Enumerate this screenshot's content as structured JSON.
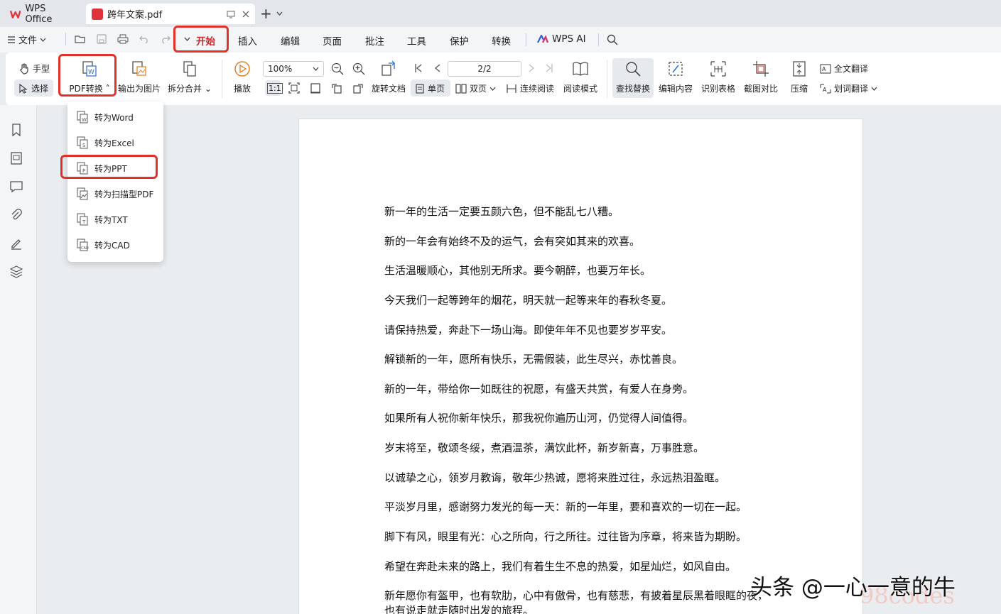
{
  "titlebar": {
    "app_tab_label": "WPS Office",
    "doc_tab_label": "跨年文案.pdf",
    "new_tab_symbol": "+",
    "brand_color": "#e0323a"
  },
  "menubar": {
    "file_label": "文件",
    "items": [
      {
        "label": "开始"
      },
      {
        "label": "插入"
      },
      {
        "label": "编辑"
      },
      {
        "label": "页面"
      },
      {
        "label": "批注"
      },
      {
        "label": "工具"
      },
      {
        "label": "保护"
      },
      {
        "label": "转换"
      }
    ],
    "ai_label": "WPS AI",
    "active_index": 0
  },
  "ribbon": {
    "hand_label": "手型",
    "select_label": "选择",
    "pdf_convert_label": "PDF转换",
    "export_image_label": "输出为图片",
    "split_merge_label": "拆分合并",
    "play_label": "播放",
    "zoom_value": "100%",
    "actual_size_label": "1:1",
    "rotate_doc_label": "旋转文档",
    "single_page_label": "单页",
    "double_page_label": "双页",
    "continuous_label": "连续阅读",
    "page_value": "2/2",
    "reading_mode_label": "阅读模式",
    "find_replace_label": "查找替换",
    "edit_content_label": "编辑内容",
    "recognize_table_label": "识别表格",
    "screenshot_compare_label": "截图对比",
    "compress_label": "压缩",
    "full_translate_label": "全文翻译",
    "word_translate_label": "划词翻译"
  },
  "dropdown": {
    "items": [
      {
        "label": "转为Word"
      },
      {
        "label": "转为Excel"
      },
      {
        "label": "转为PPT"
      },
      {
        "label": "转为扫描型PDF"
      },
      {
        "label": "转为TXT"
      },
      {
        "label": "转为CAD"
      }
    ],
    "highlighted_index": 2
  },
  "document": {
    "lines": [
      "新一年的生活一定要五颜六色，但不能乱七八糟。",
      "新的一年会有始终不及的运气，会有突如其来的欢喜。",
      "生活温暖顺心，其他别无所求。要今朝醉，也要万年长。",
      "今天我们一起等跨年的烟花，明天就一起等来年的春秋冬夏。",
      "请保持热爱，奔赴下一场山海。即使年年不见也要岁岁平安。",
      "解锁新的一年，愿所有快乐，无需假装，此生尽兴，赤忱善良。",
      "新的一年，带给你一如既往的祝愿，有盛天共赏，有爱人在身旁。",
      "如果所有人祝你新年快乐，那我祝你遍历山河，仍觉得人间值得。",
      "岁末将至，敬颂冬绥，煮酒温茶，满饮此杯，新岁新喜，万事胜意。",
      "以诚挚之心，领岁月教诲，敬年少热诚，愿将来胜过往，永远热泪盈眶。",
      "平淡岁月里，感谢努力发光的每一天：新的一年里，要和喜欢的一切在一起。",
      "脚下有风，眼里有光：心之所向，行之所往。过往皆为序章，将来皆为期盼。",
      "希望在奔赴未来的路上，我们有着生生不息的热爱，如星灿烂，如风自由。",
      "新年愿你有盔甲，也有软肋，心中有傲骨，也有慈悲，有披着星辰黑着眼眶的夜，",
      "也有说走就走随时出发的旅程。"
    ]
  },
  "watermark": {
    "text": "头条 @一心一意的牛",
    "site": "98codes"
  },
  "colors": {
    "highlight_red": "#e0322b",
    "active_menu": "#c9282d"
  }
}
